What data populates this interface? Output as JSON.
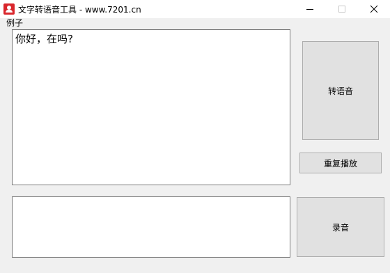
{
  "window": {
    "title": "文字转语音工具 - www.7201.cn"
  },
  "menu": {
    "items": [
      "例子"
    ]
  },
  "main_text": {
    "value": "你好，在吗?"
  },
  "record_text": {
    "value": ""
  },
  "buttons": {
    "convert": "转语音",
    "replay": "重复播放",
    "record": "录音"
  },
  "colors": {
    "app_icon": "#d9262c",
    "button_bg": "#e1e1e1",
    "window_bg": "#f0f0f0"
  },
  "icons": {
    "app": "app-icon",
    "minimize": "minimize-icon",
    "maximize": "maximize-icon",
    "close": "close-icon"
  }
}
